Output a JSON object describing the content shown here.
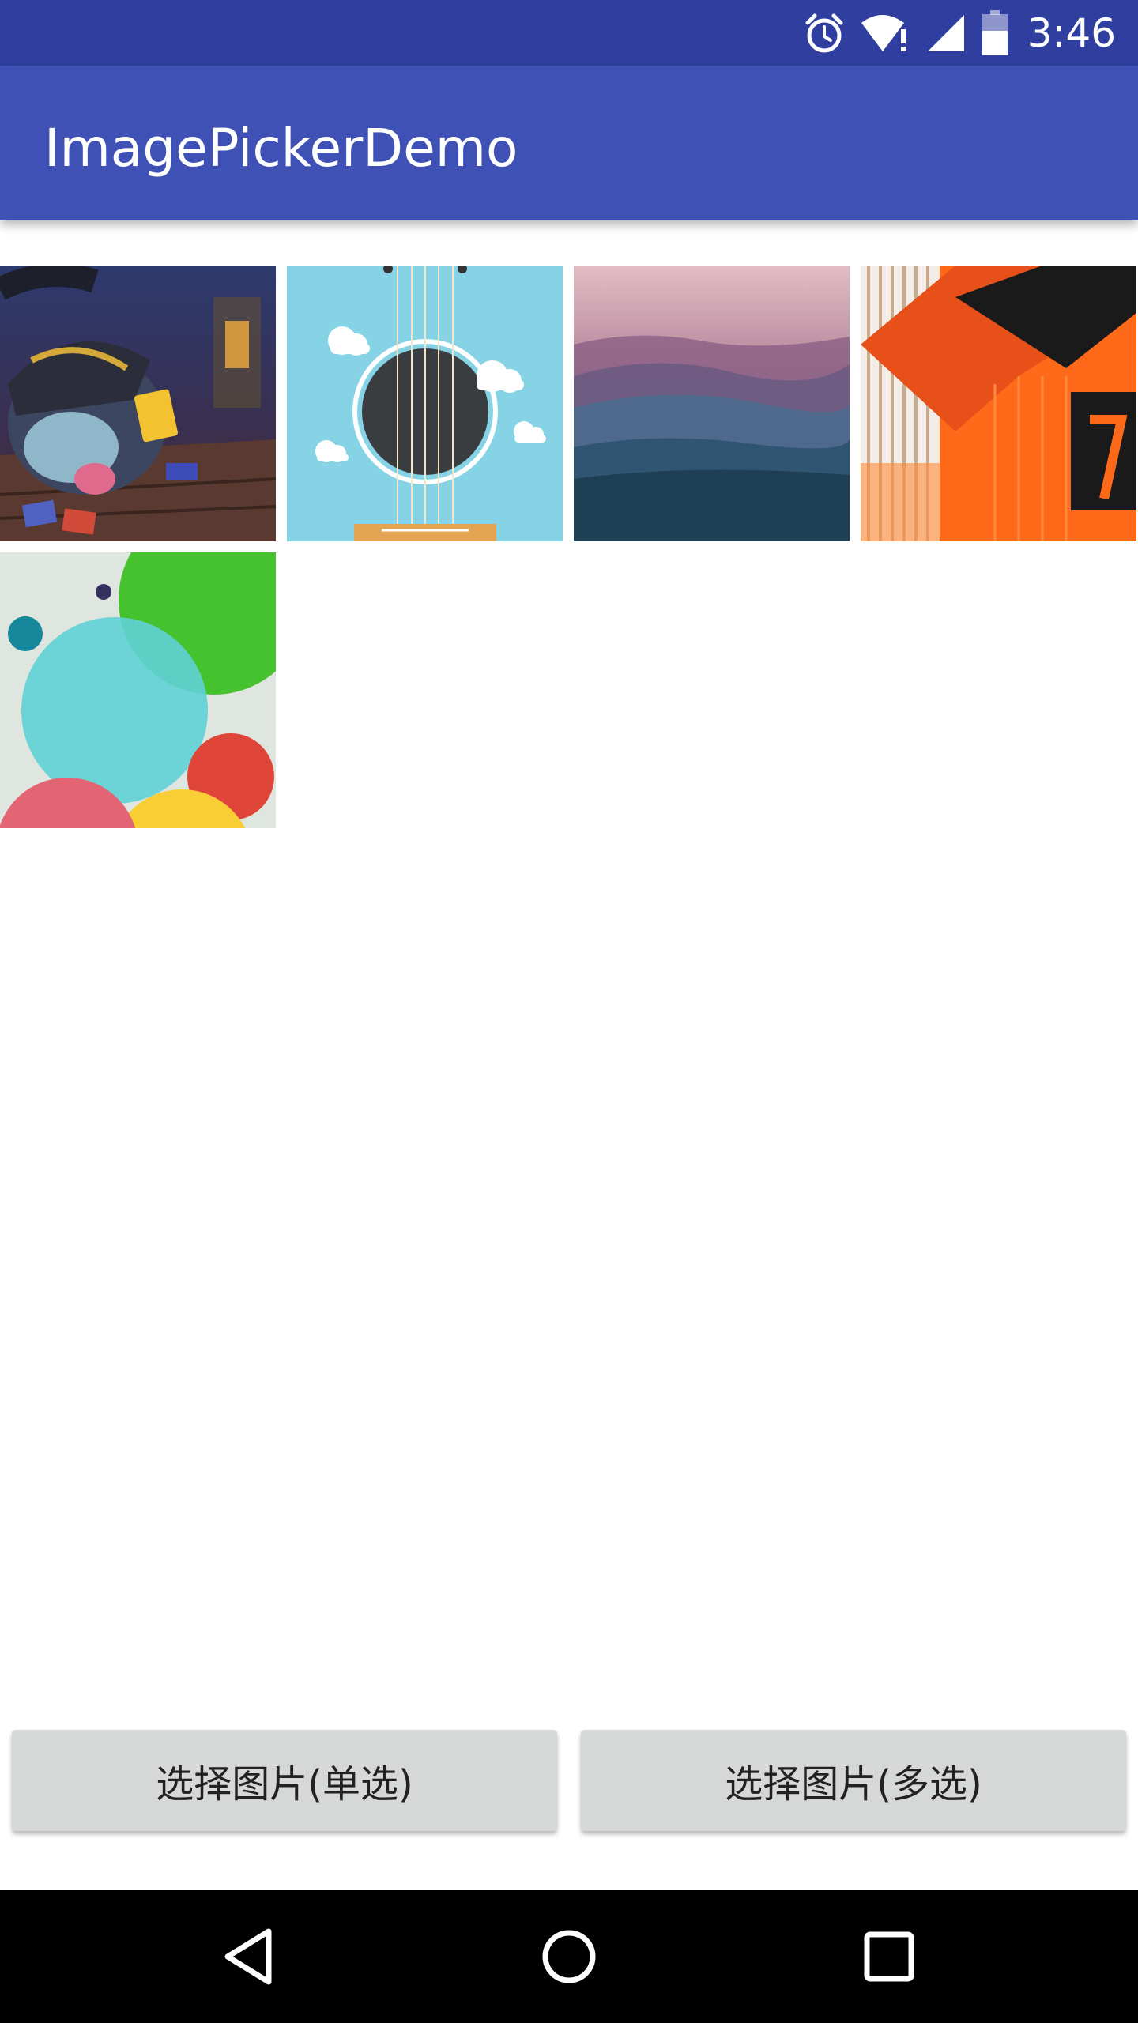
{
  "status_bar": {
    "time": "3:46",
    "icons": [
      "alarm-icon",
      "wifi-icon",
      "signal-icon",
      "battery-icon"
    ]
  },
  "app_bar": {
    "title": "ImagePickerDemo"
  },
  "images": [
    {
      "name": "image-thumb-cartoon-cat"
    },
    {
      "name": "image-thumb-guitar"
    },
    {
      "name": "image-thumb-misty-hills"
    },
    {
      "name": "image-thumb-orange-building"
    },
    {
      "name": "image-thumb-colored-circles"
    }
  ],
  "buttons": {
    "single_label": "选择图片(单选)",
    "multi_label": "选择图片(多选)"
  },
  "nav_bar": {
    "icons": [
      "back-icon",
      "home-icon",
      "recents-icon"
    ]
  },
  "colors": {
    "status_bar": "#303f9f",
    "app_bar": "#3f51b5",
    "button_bg": "#d6d7d7",
    "nav_bar": "#000000"
  }
}
